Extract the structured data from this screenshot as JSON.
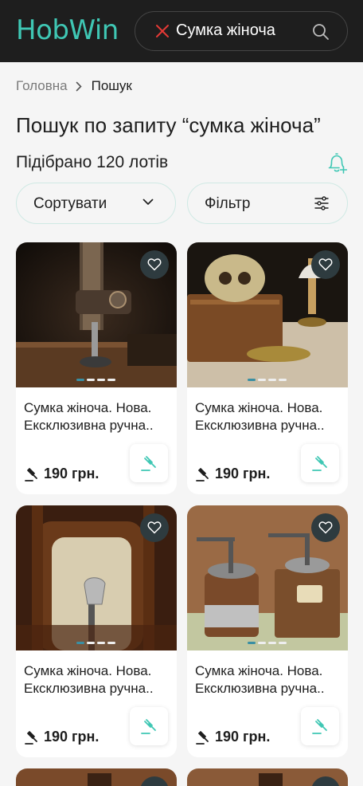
{
  "header": {
    "logo": "HobWin",
    "search_value": "Сумка жіноча",
    "clear_icon": "close-icon",
    "search_icon": "search-icon"
  },
  "breadcrumb": {
    "home": "Головна",
    "current": "Пошук"
  },
  "page": {
    "title": "Пошук по запиту “сумка жіноча”",
    "count": "Підібрано 120 лотів",
    "bell_icon": "bell-plus-icon"
  },
  "controls": {
    "sort_label": "Сортувати",
    "filter_label": "Фільтр"
  },
  "colors": {
    "accent": "#3fc7b4",
    "dark": "#1e1e1e",
    "background": "#f5f5f5",
    "fav_bg": "#2e3b3f"
  },
  "lots": [
    {
      "title_line1": "Сумка жіноча. Нова.",
      "title_line2": "Ексклюзивна ручна..",
      "price": "190 грн.",
      "image": "sewing-machine"
    },
    {
      "title_line1": "Сумка жіноча. Нова.",
      "title_line2": "Ексклюзивна ручна..",
      "price": "190 грн.",
      "image": "skull-and-oil-lamp"
    },
    {
      "title_line1": "Сумка жіноча. Нова.",
      "title_line2": "Ексклюзивна ручна..",
      "price": "190 грн.",
      "image": "cane-handle"
    },
    {
      "title_line1": "Сумка жіноча. Нова.",
      "title_line2": "Ексклюзивна ручна..",
      "price": "190 грн.",
      "image": "coffee-grinders"
    },
    {
      "image": "partial-card"
    },
    {
      "image": "partial-card"
    }
  ]
}
